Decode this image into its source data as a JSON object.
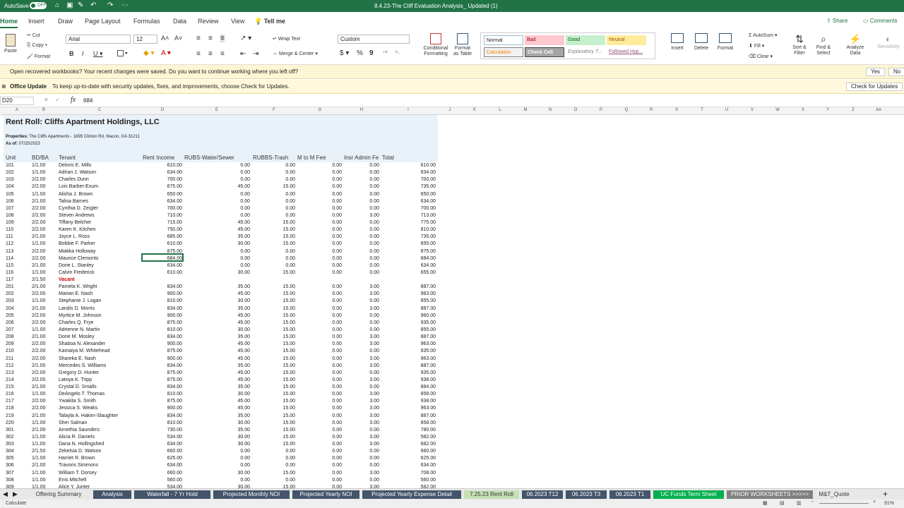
{
  "titlebar": {
    "autosave": "AutoSave",
    "autosave_state": "OFF",
    "document": "8.4.23-The Cliff  Evaluation Analysis_ Updated (1)"
  },
  "ribbon_tabs": [
    "Home",
    "Insert",
    "Draw",
    "Page Layout",
    "Formulas",
    "Data",
    "Review",
    "View"
  ],
  "tell_me": "Tell me",
  "share": "Share",
  "comments": "Comments",
  "ribbon": {
    "paste": "Paste",
    "cut": "Cut",
    "copy": "Copy",
    "format": "Format",
    "font": "Arial",
    "size": "12",
    "wrap_text": "Wrap Text",
    "merge_center": "Merge & Center",
    "number_format": "Custom",
    "conditional": "Conditional Formatting",
    "format_table": "Format as Table",
    "styles": {
      "normal": "Normal",
      "bad": "Bad",
      "good": "Good",
      "neutral": "Neutral",
      "calculation": "Calculation",
      "check_cell": "Check Cell",
      "explanatory": "Explanatory T...",
      "followed": "Followed Hyp..."
    },
    "insert": "Insert",
    "delete": "Delete",
    "format_cells": "Format",
    "autosum": "AutoSum",
    "fill": "Fill",
    "clear": "Clear",
    "sort_filter": "Sort & Filter",
    "find_select": "Find & Select",
    "analyze": "Analyze Data",
    "sensitivity": "Sensitivity"
  },
  "recovered": {
    "text": "Open recovered workbooks?  Your recent changes were saved. Do you want to continue working where you left off?",
    "yes": "Yes",
    "no": "No"
  },
  "update": {
    "label": "Office Update",
    "text": "To keep up-to-date with security updates, fixes, and improvements, choose Check for Updates.",
    "button": "Check for Updates"
  },
  "formula_bar": {
    "cell": "D20",
    "fx": "fx",
    "value": "684"
  },
  "columns": [
    "A",
    "B",
    "C",
    "D",
    "E",
    "F",
    "G",
    "H",
    "I",
    "J",
    "K",
    "L",
    "M",
    "N",
    "O",
    "P",
    "Q",
    "R",
    "S",
    "T",
    "U",
    "V",
    "W",
    "X",
    "Y",
    "Z",
    "AA"
  ],
  "sheet": {
    "title": "Rent Roll: Cliffs Apartment Holdings, LLC",
    "properties_label": "Properties:",
    "properties": "The Cliffs Apartments - 1895 Clinton Rd, Macon, GA 31211",
    "as_of_label": "As of:",
    "as_of": "07/25/2023",
    "headers": [
      "Unit",
      "BD/BA",
      "Tenant",
      "Rent Income",
      "RUBS-Water/Sewer",
      "RUBBS-Trash",
      "M to M Fee",
      "Insr Admin Fe",
      "Total"
    ],
    "rows": [
      [
        "101",
        "1/1.00",
        "Deloris E. Mills",
        "610.00",
        "0.00",
        "0.00",
        "0.00",
        "0.00",
        "610.00"
      ],
      [
        "102",
        "1/1.00",
        "Adrian J. Watson",
        "634.00",
        "0.00",
        "0.00",
        "0.00",
        "0.00",
        "634.00"
      ],
      [
        "103",
        "2/2.00",
        "Charles Dunn",
        "700.00",
        "0.00",
        "0.00",
        "0.00",
        "0.00",
        "700.00"
      ],
      [
        "104",
        "2/2.00",
        "Lois Barber-Exum",
        "675.00",
        "45.00",
        "15.00",
        "0.00",
        "0.00",
        "735.00"
      ],
      [
        "105",
        "1/1.00",
        "Alisha J. Brown",
        "650.00",
        "0.00",
        "0.00",
        "0.00",
        "0.00",
        "650.00"
      ],
      [
        "106",
        "2/1.00",
        "Talisa Barnes",
        "634.00",
        "0.00",
        "0.00",
        "0.00",
        "0.00",
        "634.00"
      ],
      [
        "107",
        "2/2.00",
        "Cynthia D. Zeigler",
        "700.00",
        "0.00",
        "0.00",
        "0.00",
        "0.00",
        "700.00"
      ],
      [
        "108",
        "2/2.00",
        "Steven Andrews",
        "710.00",
        "0.00",
        "0.00",
        "0.00",
        "3.00",
        "713.00"
      ],
      [
        "109",
        "2/2.00",
        "Tiffany Belcher",
        "715.00",
        "45.00",
        "15.00",
        "0.00",
        "0.00",
        "775.00"
      ],
      [
        "110",
        "2/2.00",
        "Karen K. Kitchen",
        "750.00",
        "45.00",
        "15.00",
        "0.00",
        "0.00",
        "810.00"
      ],
      [
        "111",
        "2/1.00",
        "Joyce L. Ross",
        "685.00",
        "35.00",
        "15.00",
        "0.00",
        "0.00",
        "735.00"
      ],
      [
        "112",
        "1/1.00",
        "Bobbie F. Parker",
        "610.00",
        "30.00",
        "15.00",
        "0.00",
        "0.00",
        "655.00"
      ],
      [
        "113",
        "2/2.00",
        "Miakka Holloway",
        "875.00",
        "0.00",
        "0.00",
        "0.00",
        "0.00",
        "875.00"
      ],
      [
        "114",
        "2/2.00",
        "Maurice Clemonts",
        "684.00",
        "0.00",
        "0.00",
        "0.00",
        "0.00",
        "684.00"
      ],
      [
        "115",
        "2/1.00",
        "Dorie L. Stanley",
        "634.00",
        "0.00",
        "0.00",
        "0.00",
        "0.00",
        "634.00"
      ],
      [
        "116",
        "1/1.00",
        "Calvin Frederick",
        "610.00",
        "30.00",
        "15.00",
        "0.00",
        "0.00",
        "655.00"
      ],
      [
        "117",
        "2/1.50",
        "Vacant",
        "",
        "",
        "",
        "",
        "",
        ""
      ],
      [
        "201",
        "2/1.00",
        "Pamela K. Wright",
        "834.00",
        "35.00",
        "15.00",
        "0.00",
        "3.00",
        "887.00"
      ],
      [
        "202",
        "2/2.00",
        "Marian E. Nash",
        "900.00",
        "45.00",
        "15.00",
        "0.00",
        "3.00",
        "963.00"
      ],
      [
        "203",
        "1/1.00",
        "Stephanie J. Logan",
        "810.00",
        "30.00",
        "15.00",
        "0.00",
        "0.00",
        "855.00"
      ],
      [
        "204",
        "2/1.00",
        "Landis D. Morris",
        "834.00",
        "35.00",
        "15.00",
        "0.00",
        "3.00",
        "887.00"
      ],
      [
        "205",
        "2/2.00",
        "Myrtice M. Johnson",
        "900.00",
        "45.00",
        "15.00",
        "0.00",
        "0.00",
        "960.00"
      ],
      [
        "206",
        "2/2.00",
        "Charles Q. Frye",
        "875.00",
        "45.00",
        "15.00",
        "0.00",
        "0.00",
        "935.00"
      ],
      [
        "207",
        "1/1.00",
        "Adrienne N. Martin",
        "810.00",
        "30.00",
        "15.00",
        "0.00",
        "0.00",
        "855.00"
      ],
      [
        "208",
        "2/1.00",
        "Dorie M. Mosley",
        "834.00",
        "35.00",
        "15.00",
        "0.00",
        "3.00",
        "887.00"
      ],
      [
        "209",
        "2/2.00",
        "Shaboa N. Alexander",
        "900.00",
        "45.00",
        "15.00",
        "0.00",
        "3.00",
        "963.00"
      ],
      [
        "210",
        "2/2.00",
        "Kamaiya M. Whitehead",
        "875.00",
        "45.00",
        "15.00",
        "0.00",
        "0.00",
        "935.00"
      ],
      [
        "211",
        "2/2.00",
        "Shareka E. Nash",
        "900.00",
        "45.00",
        "15.00",
        "0.00",
        "3.00",
        "963.00"
      ],
      [
        "212",
        "2/1.00",
        "Mercedes S. Williams",
        "834.00",
        "35.00",
        "15.00",
        "0.00",
        "3.00",
        "887.00"
      ],
      [
        "213",
        "2/2.00",
        "Gregory D. Hunter",
        "875.00",
        "45.00",
        "15.00",
        "0.00",
        "0.00",
        "935.00"
      ],
      [
        "214",
        "2/2.00",
        "Latoya K. Tripp",
        "875.00",
        "45.00",
        "15.00",
        "0.00",
        "3.00",
        "938.00"
      ],
      [
        "215",
        "2/1.00",
        "Crystal D. Smalls",
        "834.00",
        "35.00",
        "15.00",
        "0.00",
        "0.00",
        "884.00"
      ],
      [
        "216",
        "1/1.00",
        "DeAngelo T. Thomas",
        "810.00",
        "30.00",
        "15.00",
        "0.00",
        "3.00",
        "858.00"
      ],
      [
        "217",
        "2/2.00",
        "Ywakita S. Smith",
        "875.00",
        "45.00",
        "15.00",
        "0.00",
        "3.00",
        "938.00"
      ],
      [
        "218",
        "2/2.00",
        "Jessica S. Weaks",
        "900.00",
        "45.00",
        "15.00",
        "0.00",
        "3.00",
        "963.00"
      ],
      [
        "219",
        "2/1.00",
        "Talayla A. Hakim-Slaughter",
        "834.00",
        "35.00",
        "15.00",
        "0.00",
        "3.00",
        "887.00"
      ],
      [
        "220",
        "1/1.00",
        "Sher Salman",
        "810.00",
        "30.00",
        "15.00",
        "0.00",
        "3.00",
        "858.00"
      ],
      [
        "301",
        "2/1.00",
        "Arnethia Saunders",
        "730.00",
        "35.00",
        "15.00",
        "0.00",
        "0.00",
        "780.00"
      ],
      [
        "302",
        "1/1.00",
        "Alicia R. Daniels",
        "534.00",
        "30.00",
        "15.00",
        "0.00",
        "3.00",
        "582.00"
      ],
      [
        "303",
        "1/1.00",
        "Dana N. Hollingshed",
        "634.00",
        "30.00",
        "15.00",
        "0.00",
        "3.00",
        "682.00"
      ],
      [
        "304",
        "2/1.50",
        "Zekelsia D. Watson",
        "660.00",
        "0.00",
        "0.00",
        "0.00",
        "0.00",
        "660.00"
      ],
      [
        "305",
        "1/1.00",
        "Harriet R. Brown",
        "625.00",
        "0.00",
        "0.00",
        "0.00",
        "0.00",
        "625.00"
      ],
      [
        "306",
        "2/1.00",
        "Travoris Simmons",
        "634.00",
        "0.00",
        "0.00",
        "0.00",
        "0.00",
        "634.00"
      ],
      [
        "307",
        "1/1.00",
        "William T. Dorsey",
        "660.00",
        "30.00",
        "15.00",
        "0.00",
        "3.00",
        "708.00"
      ],
      [
        "308",
        "1/1.00",
        "Enis Mitchell",
        "560.00",
        "0.00",
        "0.00",
        "0.00",
        "0.00",
        "560.00"
      ],
      [
        "309",
        "1/1.00",
        "Alice Y. Junter",
        "534.00",
        "30.00",
        "15.00",
        "0.00",
        "3.00",
        "582.00"
      ]
    ]
  },
  "sheet_tabs": [
    {
      "label": "Offering Summary",
      "color": "#e8e8e8",
      "text": "#333"
    },
    {
      "label": "Analysis",
      "color": "#44546a",
      "text": "#fff"
    },
    {
      "label": "Waterfall - 7 Yr Hold",
      "color": "#44546a",
      "text": "#fff"
    },
    {
      "label": "Projected Monthly NOI",
      "color": "#44546a",
      "text": "#fff"
    },
    {
      "label": "Projected Yearly NOI",
      "color": "#44546a",
      "text": "#fff"
    },
    {
      "label": "Projected Yearly Expense Detail",
      "color": "#44546a",
      "text": "#fff"
    },
    {
      "label": "7.25.23 Rent Roll",
      "color": "#c6e0b4",
      "text": "#333"
    },
    {
      "label": "06.2023 T12",
      "color": "#44546a",
      "text": "#fff"
    },
    {
      "label": "06.2023 T3",
      "color": "#44546a",
      "text": "#fff"
    },
    {
      "label": "06.2023 T1",
      "color": "#44546a",
      "text": "#fff"
    },
    {
      "label": "UC Funds Term Sheet",
      "color": "#00b050",
      "text": "#fff"
    },
    {
      "label": "PRIOR WORKSHEETS >>>>>",
      "color": "#7f7f7f",
      "text": "#fff"
    },
    {
      "label": "M&T_Quote",
      "color": "#e8e8e8",
      "text": "#333"
    }
  ],
  "status": {
    "mode": "Calculate",
    "zoom": "91%"
  }
}
